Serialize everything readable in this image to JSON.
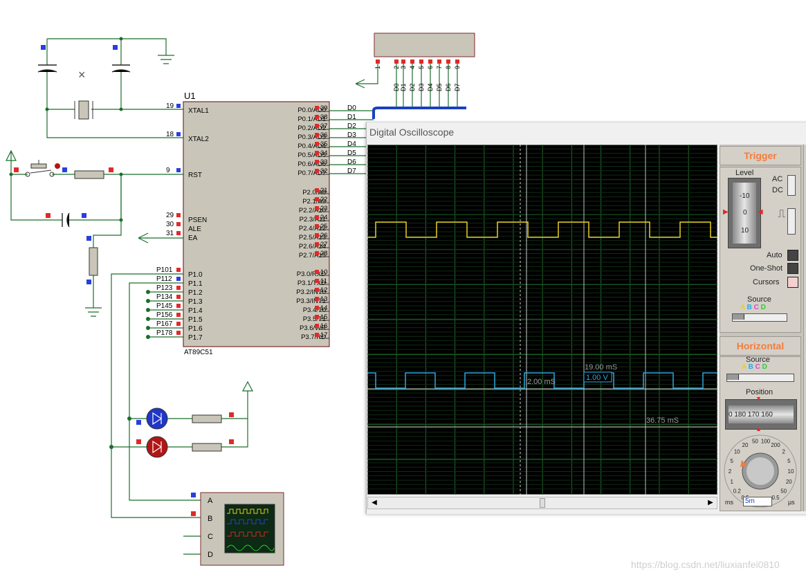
{
  "schematic": {
    "chip_ref": "U1",
    "chip_part": "AT89C51",
    "left_pins": [
      {
        "num": "19",
        "name": "XTAL1"
      },
      {
        "num": "18",
        "name": "XTAL2"
      },
      {
        "num": "9",
        "name": "RST"
      },
      {
        "num": "29",
        "name": "PSEN"
      },
      {
        "num": "30",
        "name": "ALE"
      },
      {
        "num": "31",
        "name": "EA"
      }
    ],
    "p1_pins": [
      {
        "num": "P101",
        "name": "P1.0"
      },
      {
        "num": "P112",
        "name": "P1.1"
      },
      {
        "num": "P123",
        "name": "P1.2"
      },
      {
        "num": "P134",
        "name": "P1.3"
      },
      {
        "num": "P145",
        "name": "P1.4"
      },
      {
        "num": "P156",
        "name": "P1.5"
      },
      {
        "num": "P167",
        "name": "P1.6"
      },
      {
        "num": "P178",
        "name": "P1.7"
      }
    ],
    "right_pins": [
      {
        "name": "P0.0/AD0",
        "num": "39",
        "net": "D0"
      },
      {
        "name": "P0.1/AD1",
        "num": "38",
        "net": "D1"
      },
      {
        "name": "P0.2/AD2",
        "num": "37",
        "net": "D2"
      },
      {
        "name": "P0.3/AD3",
        "num": "36",
        "net": "D3"
      },
      {
        "name": "P0.4/AD4",
        "num": "35",
        "net": "D4"
      },
      {
        "name": "P0.5/AD5",
        "num": "34",
        "net": "D5"
      },
      {
        "name": "P0.6/AD6",
        "num": "33",
        "net": "D6"
      },
      {
        "name": "P0.7/AD7",
        "num": "32",
        "net": "D7"
      },
      {
        "name": "P2.0/A8",
        "num": "21",
        "net": ""
      },
      {
        "name": "P2.1/A9",
        "num": "22",
        "net": ""
      },
      {
        "name": "P2.2/A10",
        "num": "23",
        "net": ""
      },
      {
        "name": "P2.3/A11",
        "num": "24",
        "net": ""
      },
      {
        "name": "P2.4/A12",
        "num": "25",
        "net": ""
      },
      {
        "name": "P2.5/A13",
        "num": "26",
        "net": ""
      },
      {
        "name": "P2.6/A14",
        "num": "27",
        "net": ""
      },
      {
        "name": "P2.7/A15",
        "num": "28",
        "net": ""
      },
      {
        "name": "P3.0/RXD",
        "num": "10",
        "net": ""
      },
      {
        "name": "P3.1/TXD",
        "num": "11",
        "net": ""
      },
      {
        "name": "P3.2/INT0",
        "num": "12",
        "net": ""
      },
      {
        "name": "P3.3/INT1",
        "num": "13",
        "net": ""
      },
      {
        "name": "P3.4/T0",
        "num": "14",
        "net": ""
      },
      {
        "name": "P3.5/T1",
        "num": "15",
        "net": ""
      },
      {
        "name": "P3.6/WR",
        "num": "16",
        "net": ""
      },
      {
        "name": "P3.7/RD",
        "num": "17",
        "net": ""
      }
    ],
    "connector_pins": [
      "1",
      "2",
      "3",
      "4",
      "5",
      "6",
      "7",
      "8",
      "9"
    ],
    "connector_nets": [
      "D0",
      "D1",
      "D2",
      "D3",
      "D4",
      "D5",
      "D6",
      "D7"
    ],
    "scope_channels": [
      "A",
      "B",
      "C",
      "D"
    ]
  },
  "oscilloscope": {
    "window_title": "Digital Oscilloscope",
    "readouts": {
      "cursor_time_1": "19.00 mS",
      "cursor_volt": "1.00 V",
      "cursor_time_2": "2.00 mS",
      "cursor_time_3": "36.75 mS"
    },
    "trigger": {
      "header": "Trigger",
      "level_label": "Level",
      "level_scale": [
        "-10",
        "0",
        "10"
      ],
      "ac": "AC",
      "dc": "DC",
      "auto": "Auto",
      "one_shot": "One-Shot",
      "cursors": "Cursors",
      "source_label": "Source",
      "source_channels": [
        "A",
        "B",
        "C",
        "D"
      ]
    },
    "horizontal": {
      "header": "Horizontal",
      "source_label": "Source",
      "source_channels": [
        "A",
        "B",
        "C",
        "D"
      ],
      "position_label": "Position",
      "position_scale": [
        "0",
        "180",
        "170",
        "160"
      ],
      "dial_marks": [
        "0.5",
        "0.2",
        "1",
        "2",
        "5",
        "10",
        "20",
        "50",
        "100",
        "200",
        "2",
        "5",
        "10",
        "20",
        "50",
        "0.5"
      ],
      "unit_ms": "ms",
      "unit_us": "µs",
      "timebase_value": "5m"
    },
    "colors": {
      "channel_a": "#e8d021",
      "channel_b": "#2aa9e0",
      "grid": "#1f6b2a",
      "screen_bg": "#000000",
      "accent": "#f47c3c"
    }
  },
  "watermark": "https://blog.csdn.net/liuxianfei0810"
}
